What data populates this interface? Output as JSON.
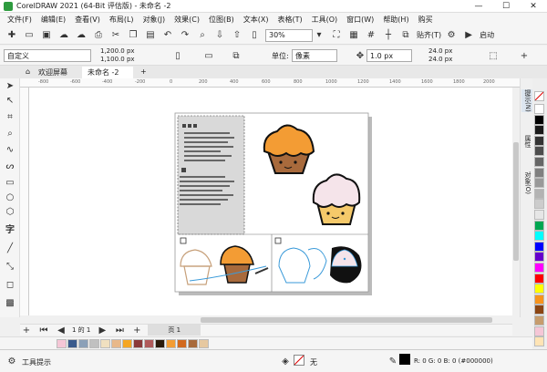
{
  "app": {
    "title": "CorelDRAW 2021 (64-Bit 评估版) - 未命名 -2"
  },
  "window_controls": {
    "minimize": "—",
    "maximize": "☐",
    "close": "✕"
  },
  "menu": [
    "文件(F)",
    "编辑(E)",
    "查看(V)",
    "布局(L)",
    "对象(J)",
    "效果(C)",
    "位图(B)",
    "文本(X)",
    "表格(T)",
    "工具(O)",
    "窗口(W)",
    "帮助(H)",
    "购买"
  ],
  "toolbar": {
    "zoom": "30%",
    "snap_label": "贴齐(T)",
    "launch_label": "启动"
  },
  "property_bar": {
    "preset": "自定义",
    "width": "1,200.0 px",
    "height": "1,100.0 px",
    "units_label": "单位:",
    "units_value": "像素",
    "nudge": "1.0 px",
    "dup_x": "24.0 px",
    "dup_y": "24.0 px"
  },
  "doc_tabs": {
    "home": "欢迎屏幕",
    "doc": "未命名 -2",
    "add": "+"
  },
  "ruler": {
    "marks": [
      "-800",
      "-600",
      "-400",
      "-200",
      "0",
      "200",
      "400",
      "600",
      "800",
      "1000",
      "1200",
      "1400",
      "1600",
      "1800",
      "2000",
      "2200"
    ]
  },
  "dockers": [
    "提示(N)",
    "属性",
    "对象(O)"
  ],
  "page_nav": {
    "page_counter": "1 的 1",
    "page_tab": "页 1"
  },
  "status": {
    "tool_hint": "工具提示",
    "fill_none": "无",
    "color_readout": "R: 0 G: 0 B: 0 (#000000)"
  },
  "colors": {
    "accent": "#0e7acc",
    "cupcake_orange": "#f39c34",
    "cupcake_brown": "#a86a3c",
    "cupcake_pink": "#f5c6d6"
  },
  "palette_colors": [
    "#ffffff",
    "#000000",
    "#1a1a1a",
    "#333333",
    "#4d4d4d",
    "#666666",
    "#808080",
    "#999999",
    "#b3b3b3",
    "#cccccc",
    "#e6e6e6",
    "#00a651",
    "#00ffff",
    "#0000ff",
    "#6600cc",
    "#ff00ff",
    "#ff0000",
    "#ffff00",
    "#f7941d",
    "#8b4513",
    "#c69c6d",
    "#f5c6d6",
    "#ffe4b5"
  ],
  "doc_palette": [
    "#f5c6d6",
    "#3a5a8c",
    "#8ba0b8",
    "#c0c0c0",
    "#f0e0c0",
    "#e8b88a",
    "#f5a623",
    "#8b3a3a",
    "#b05a5a",
    "#2b1a0a",
    "#f39c34",
    "#d2691e",
    "#a86a3c",
    "#e6c8a0"
  ]
}
